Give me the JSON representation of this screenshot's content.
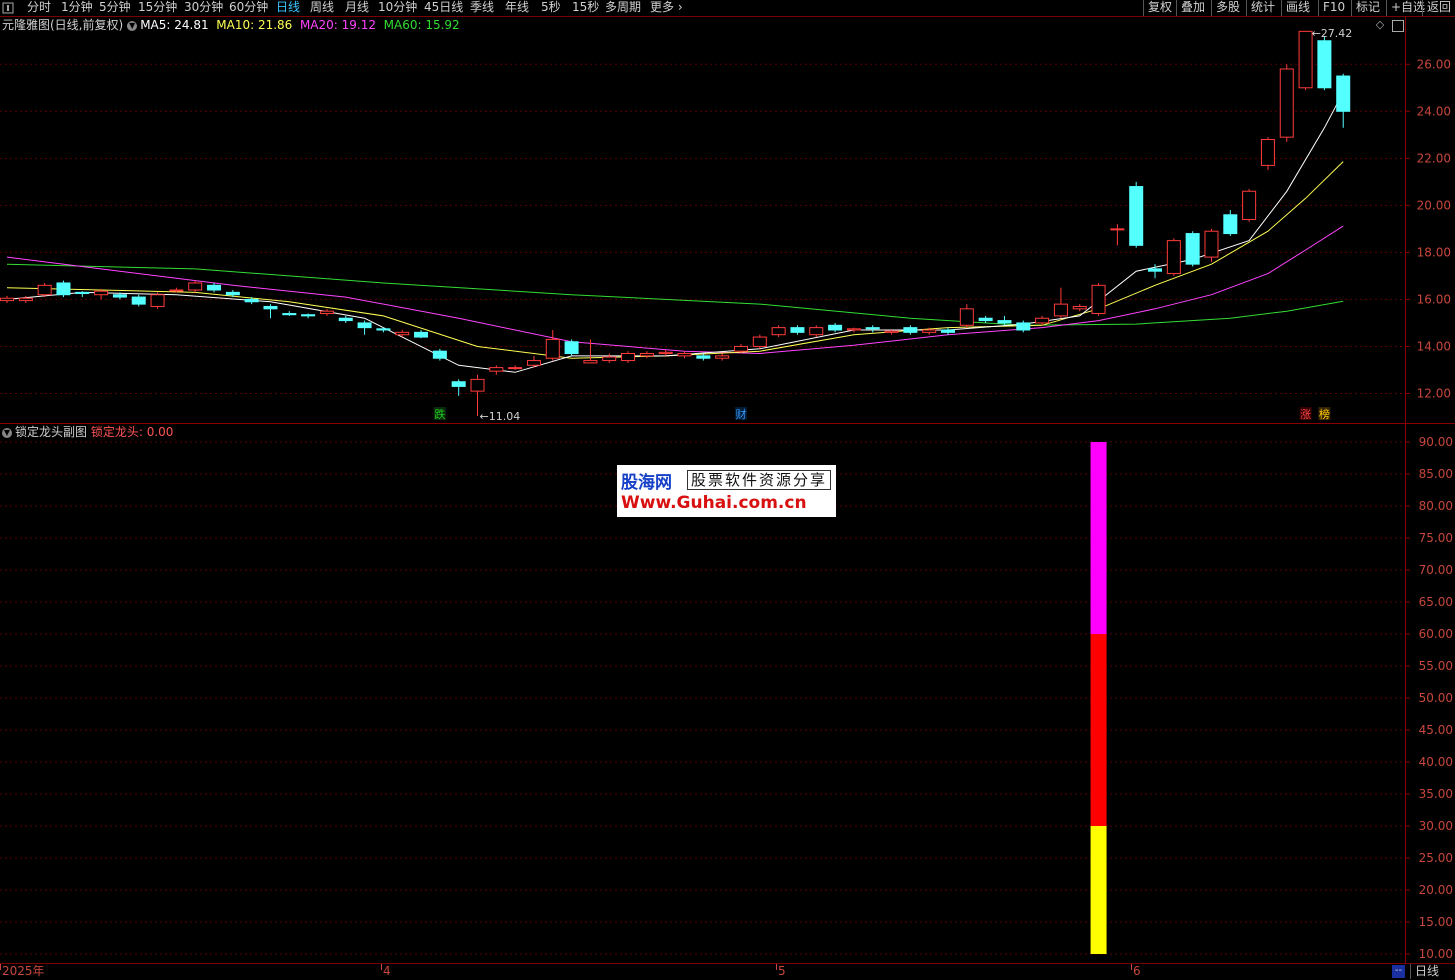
{
  "toolbar": {
    "left_icon": "panel-toggle-icon",
    "periods": [
      "分时",
      "1分钟",
      "5分钟",
      "15分钟",
      "30分钟",
      "60分钟",
      "日线",
      "周线",
      "月线",
      "10分钟",
      "45日线",
      "季线",
      "年线",
      "5秒",
      "15秒",
      "多周期",
      "更多"
    ],
    "active_period": "日线",
    "right": [
      "复权",
      "叠加",
      "多股",
      "统计",
      "画线",
      "F10",
      "标记",
      "+自选",
      "返回"
    ]
  },
  "main_chart": {
    "title": "元隆雅图(日线,前复权)",
    "ma": [
      {
        "label": "MA5: 24.81",
        "color": "#ffffff"
      },
      {
        "label": "MA10: 21.86",
        "color": "#ffff55"
      },
      {
        "label": "MA20: 19.12",
        "color": "#ff44ff"
      },
      {
        "label": "MA60: 15.92",
        "color": "#33dd33"
      }
    ],
    "high_label": "27.42",
    "low_label": "11.04",
    "markers": [
      {
        "text": "跌",
        "color": "#22cc22",
        "bg": "#0a2a0a"
      },
      {
        "text": "财",
        "color": "#3399ff",
        "bg": "#001a33"
      },
      {
        "text": "涨",
        "color": "#ff4444",
        "bg": "#330000"
      },
      {
        "text": "榜",
        "color": "#ffcc00",
        "bg": "#332200"
      }
    ],
    "y_ticks": [
      "26.00",
      "24.00",
      "22.00",
      "20.00",
      "18.00",
      "16.00",
      "14.00",
      "12.00"
    ],
    "window_icons": [
      "diamond-icon",
      "window-restore-icon"
    ]
  },
  "sub_chart": {
    "title": "锁定龙头副图",
    "value_label": "锁定龙头: 0.00",
    "y_ticks": [
      "90.00",
      "85.00",
      "80.00",
      "75.00",
      "70.00",
      "65.00",
      "60.00",
      "55.00",
      "50.00",
      "45.00",
      "40.00",
      "35.00",
      "30.00",
      "25.00",
      "20.00",
      "15.00",
      "10.00"
    ],
    "bar_segments": [
      {
        "from": 10,
        "to": 30,
        "color": "#ffff00"
      },
      {
        "from": 30,
        "to": 60,
        "color": "#ff0000"
      },
      {
        "from": 60,
        "to": 90,
        "color": "#ff00ff"
      }
    ]
  },
  "watermark": {
    "line1": "股海网",
    "line1b": "股票软件资源分享",
    "line2": "Www.Guhai.com.cn"
  },
  "bottom_axis": {
    "dates": [
      "2025年",
      "4",
      "5",
      "6"
    ],
    "right_tab": "日线",
    "corner": "--"
  },
  "chart_data": {
    "type": "candlestick",
    "y_range": [
      11,
      27.5
    ],
    "candles": [
      [
        15.95,
        16.05,
        16.15,
        15.85
      ],
      [
        15.95,
        16.05,
        16.15,
        15.85
      ],
      [
        16.2,
        16.6,
        16.7,
        16.1
      ],
      [
        16.7,
        16.2,
        16.8,
        16.1
      ],
      [
        16.3,
        16.25,
        16.35,
        16.1
      ],
      [
        16.2,
        16.35,
        16.45,
        16.0
      ],
      [
        16.2,
        16.1,
        16.3,
        16.0
      ],
      [
        16.1,
        15.8,
        16.2,
        15.7
      ],
      [
        15.7,
        16.2,
        16.3,
        15.6
      ],
      [
        16.4,
        16.4,
        16.5,
        16.3
      ],
      [
        16.4,
        16.7,
        16.8,
        16.3
      ],
      [
        16.6,
        16.4,
        16.7,
        16.3
      ],
      [
        16.3,
        16.2,
        16.4,
        16.1
      ],
      [
        16.0,
        15.9,
        16.1,
        15.8
      ],
      [
        15.7,
        15.6,
        15.8,
        15.2
      ],
      [
        15.4,
        15.35,
        15.5,
        15.3
      ],
      [
        15.35,
        15.3,
        15.4,
        15.2
      ],
      [
        15.4,
        15.5,
        15.6,
        15.3
      ],
      [
        15.2,
        15.1,
        15.3,
        15.0
      ],
      [
        15.0,
        14.8,
        15.1,
        14.5
      ],
      [
        14.75,
        14.7,
        14.8,
        14.6
      ],
      [
        14.5,
        14.6,
        14.7,
        14.4
      ],
      [
        14.6,
        14.4,
        14.7,
        14.35
      ],
      [
        13.8,
        13.5,
        13.9,
        13.4
      ],
      [
        12.5,
        12.3,
        12.6,
        11.9
      ],
      [
        12.1,
        12.6,
        12.8,
        11.04
      ],
      [
        12.95,
        13.1,
        13.2,
        12.8
      ],
      [
        13.1,
        13.1,
        13.2,
        13.0
      ],
      [
        13.2,
        13.4,
        13.6,
        13.1
      ],
      [
        13.5,
        14.3,
        14.7,
        13.4
      ],
      [
        14.2,
        13.7,
        14.3,
        13.6
      ],
      [
        13.3,
        13.4,
        14.3,
        13.3
      ],
      [
        13.4,
        13.55,
        13.7,
        13.3
      ],
      [
        13.4,
        13.7,
        13.8,
        13.3
      ],
      [
        13.6,
        13.7,
        13.8,
        13.5
      ],
      [
        13.7,
        13.75,
        13.85,
        13.6
      ],
      [
        13.6,
        13.7,
        13.8,
        13.5
      ],
      [
        13.6,
        13.5,
        13.7,
        13.4
      ],
      [
        13.5,
        13.6,
        13.7,
        13.4
      ],
      [
        13.8,
        14.0,
        14.1,
        13.7
      ],
      [
        14.0,
        14.4,
        14.5,
        13.9
      ],
      [
        14.5,
        14.8,
        14.9,
        14.4
      ],
      [
        14.8,
        14.6,
        14.9,
        14.5
      ],
      [
        14.5,
        14.8,
        14.9,
        14.4
      ],
      [
        14.9,
        14.7,
        15.0,
        14.6
      ],
      [
        14.7,
        14.75,
        14.8,
        14.6
      ],
      [
        14.8,
        14.75,
        14.9,
        14.6
      ],
      [
        14.6,
        14.65,
        14.7,
        14.5
      ],
      [
        14.8,
        14.6,
        14.9,
        14.5
      ],
      [
        14.6,
        14.7,
        14.8,
        14.5
      ],
      [
        14.7,
        14.6,
        14.8,
        14.5
      ],
      [
        14.9,
        15.6,
        15.8,
        14.8
      ],
      [
        15.2,
        15.1,
        15.3,
        15.0
      ],
      [
        15.1,
        15.0,
        15.3,
        14.9
      ],
      [
        15.0,
        14.7,
        15.1,
        14.6
      ],
      [
        15.0,
        15.2,
        15.3,
        14.9
      ],
      [
        15.3,
        15.8,
        16.5,
        15.2
      ],
      [
        15.6,
        15.7,
        15.8,
        15.5
      ],
      [
        15.4,
        16.6,
        16.7,
        15.3
      ],
      [
        19.0,
        19.0,
        19.2,
        18.3
      ],
      [
        20.8,
        18.3,
        21.0,
        18.2
      ],
      [
        17.3,
        17.2,
        17.5,
        16.9
      ],
      [
        17.1,
        18.5,
        18.6,
        17.0
      ],
      [
        18.8,
        17.5,
        18.9,
        17.4
      ],
      [
        17.8,
        18.9,
        19.0,
        17.6
      ],
      [
        19.6,
        18.8,
        19.8,
        18.7
      ],
      [
        19.4,
        20.6,
        20.7,
        19.3
      ],
      [
        21.7,
        22.8,
        22.9,
        21.5
      ],
      [
        22.9,
        25.8,
        26.0,
        22.7
      ],
      [
        25.0,
        27.4,
        27.42,
        24.9
      ],
      [
        27.0,
        25.0,
        27.2,
        24.9
      ],
      [
        25.5,
        24.0,
        25.6,
        23.3
      ]
    ],
    "ma5": [
      [
        0,
        16.0
      ],
      [
        4,
        16.3
      ],
      [
        9,
        16.2
      ],
      [
        14,
        15.9
      ],
      [
        19,
        15.2
      ],
      [
        24,
        13.2
      ],
      [
        27,
        12.9
      ],
      [
        30,
        13.6
      ],
      [
        35,
        13.6
      ],
      [
        40,
        13.9
      ],
      [
        45,
        14.7
      ],
      [
        50,
        14.7
      ],
      [
        54,
        14.95
      ],
      [
        57,
        15.3
      ],
      [
        60,
        17.2
      ],
      [
        63,
        17.7
      ],
      [
        66,
        18.5
      ],
      [
        68,
        20.6
      ],
      [
        70,
        23.3
      ],
      [
        71,
        24.81
      ]
    ],
    "ma10": [
      [
        0,
        16.5
      ],
      [
        5,
        16.4
      ],
      [
        10,
        16.3
      ],
      [
        15,
        15.9
      ],
      [
        20,
        15.3
      ],
      [
        25,
        14.0
      ],
      [
        30,
        13.5
      ],
      [
        35,
        13.6
      ],
      [
        40,
        13.8
      ],
      [
        45,
        14.5
      ],
      [
        50,
        14.8
      ],
      [
        55,
        14.9
      ],
      [
        58,
        15.6
      ],
      [
        61,
        16.6
      ],
      [
        64,
        17.5
      ],
      [
        67,
        18.9
      ],
      [
        69,
        20.3
      ],
      [
        71,
        21.86
      ]
    ],
    "ma20": [
      [
        0,
        17.8
      ],
      [
        6,
        17.2
      ],
      [
        12,
        16.6
      ],
      [
        18,
        16.1
      ],
      [
        24,
        15.2
      ],
      [
        30,
        14.2
      ],
      [
        36,
        13.8
      ],
      [
        40,
        13.7
      ],
      [
        45,
        14.05
      ],
      [
        50,
        14.5
      ],
      [
        55,
        14.8
      ],
      [
        58,
        15.1
      ],
      [
        61,
        15.6
      ],
      [
        64,
        16.2
      ],
      [
        67,
        17.1
      ],
      [
        69,
        18.1
      ],
      [
        71,
        19.12
      ]
    ],
    "ma60": [
      [
        0,
        17.5
      ],
      [
        10,
        17.3
      ],
      [
        20,
        16.7
      ],
      [
        30,
        16.2
      ],
      [
        40,
        15.8
      ],
      [
        48,
        15.2
      ],
      [
        54,
        14.9
      ],
      [
        60,
        14.95
      ],
      [
        65,
        15.2
      ],
      [
        68,
        15.5
      ],
      [
        71,
        15.92
      ]
    ],
    "sub_bar_index": 58
  }
}
